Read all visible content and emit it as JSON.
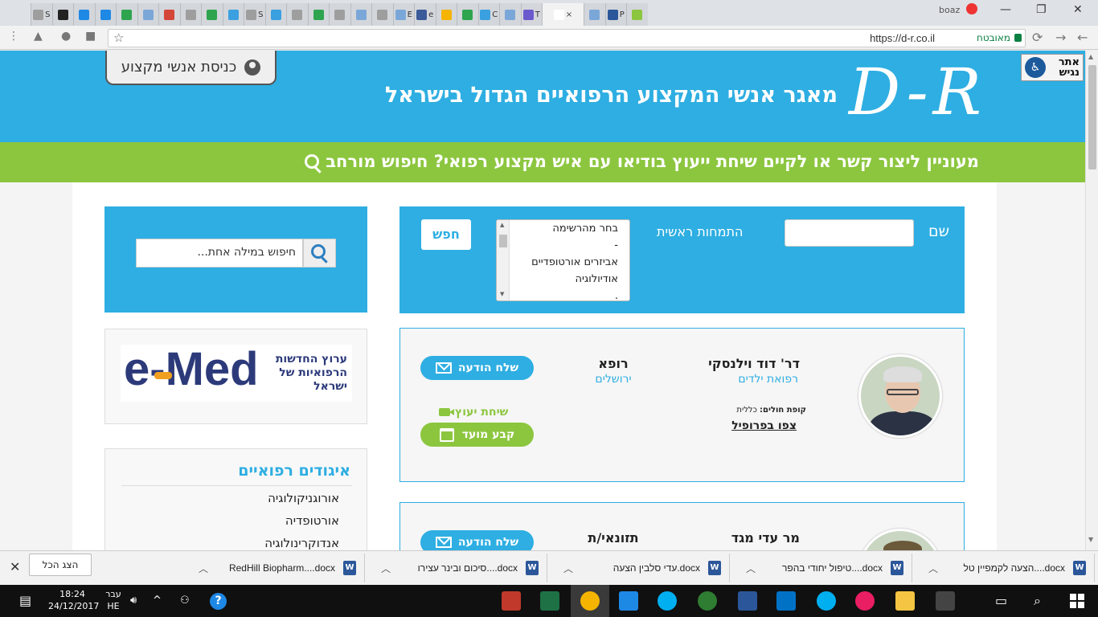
{
  "browser": {
    "tabs": [
      {
        "letter": "S",
        "color": "#9e9e9e"
      },
      {
        "letter": "",
        "color": "#222222"
      },
      {
        "letter": "",
        "color": "#1e88e5"
      },
      {
        "letter": "",
        "color": "#1e88e5"
      },
      {
        "letter": "",
        "color": "#2ea44f"
      },
      {
        "letter": "",
        "color": "#7aa7d8"
      },
      {
        "letter": "",
        "color": "#d44638"
      },
      {
        "letter": "",
        "color": "#9e9e9e"
      },
      {
        "letter": "",
        "color": "#2ea44f"
      },
      {
        "letter": "",
        "color": "#3aa0e0"
      },
      {
        "letter": "S",
        "color": "#9e9e9e"
      },
      {
        "letter": "",
        "color": "#3aa0e0"
      },
      {
        "letter": "",
        "color": "#9e9e9e"
      },
      {
        "letter": "",
        "color": "#2ea44f"
      },
      {
        "letter": "",
        "color": "#9e9e9e"
      },
      {
        "letter": "",
        "color": "#7aa7d8"
      },
      {
        "letter": "",
        "color": "#9e9e9e"
      },
      {
        "letter": "E",
        "color": "#7aa7d8"
      },
      {
        "letter": "e",
        "color": "#3a5a99"
      },
      {
        "letter": "",
        "color": "#f4b400"
      },
      {
        "letter": "",
        "color": "#2ea44f"
      },
      {
        "letter": "C",
        "color": "#3aa0e0"
      },
      {
        "letter": "",
        "color": "#7aa7d8"
      },
      {
        "letter": "T",
        "color": "#6a5acd"
      },
      {
        "letter": "",
        "color": "#ffffff"
      },
      {
        "letter": "",
        "color": "#7aa7d8"
      },
      {
        "letter": "P",
        "color": "#2b579a"
      },
      {
        "letter": "",
        "color": "#8cc63f"
      }
    ],
    "active_tab_close": "×",
    "user_name": "boaz",
    "window_controls": {
      "minimize": "—",
      "restore": "❐",
      "close": "✕"
    },
    "url": "https://d-r.co.il",
    "secure_label": "מאובטח"
  },
  "site": {
    "login_button": "כניסת אנשי מקצוע",
    "tagline": "מאגר אנשי המקצוע הרפואיים הגדול בישראל",
    "logo": "D-R",
    "accessibility_label": [
      "אתר",
      "נגיש"
    ],
    "green_banner": "מעוניין ליצור קשר או לקיים שיחת ייעוץ בודיאו עם איש מקצוע רפואי? חיפוש מורחב"
  },
  "search": {
    "name_label": "שם",
    "specialty_label": "התמחות ראשית",
    "specialty_options": [
      "בחר מהרשימה",
      "-",
      "אביזרים אורטופדיים",
      "אודיולוגיה",
      "."
    ],
    "search_button": "חפש",
    "keyword_placeholder": "חיפוש במילה אחת..."
  },
  "emed": {
    "logo": "e-Med",
    "text": "ערוץ החדשות הרפואיות של ישראל"
  },
  "associations": {
    "title": "איגודים רפואיים",
    "items": [
      "אורוגניקולוגיה",
      "אורטופדיה",
      "אנדוקרינולוגיה"
    ]
  },
  "doctors": [
    {
      "name": "דר' דוד וילנסקי",
      "specialty": "רפואת ילדים",
      "role": "רופא",
      "city": "ירושלים",
      "kupa_label": "קופת חולים:",
      "kupa_value": "כללית",
      "profile_link": "צפו בפרופיל",
      "message_button": "שלח הודעה",
      "consult_label": "שיחת יעוץ",
      "appointment_button": "קבע מועד"
    },
    {
      "name": "מר עדי מגד",
      "role": "תזונאי/ת",
      "message_button": "שלח הודעה"
    }
  ],
  "downloads": {
    "show_all": "הצג הכל",
    "close": "✕",
    "items": [
      "RedHill Biopharm....docx",
      "סיכום ובינר עצירו....docx",
      "עדי סלבין הצעה.docx",
      "טיפול יחודי בהפר....docx",
      "הצעה לקמפיין טל....docx"
    ]
  },
  "taskbar": {
    "time": "18:24",
    "date": "24/12/2017",
    "lang_top": "עבר",
    "lang_bottom": "HE",
    "help": "?"
  }
}
